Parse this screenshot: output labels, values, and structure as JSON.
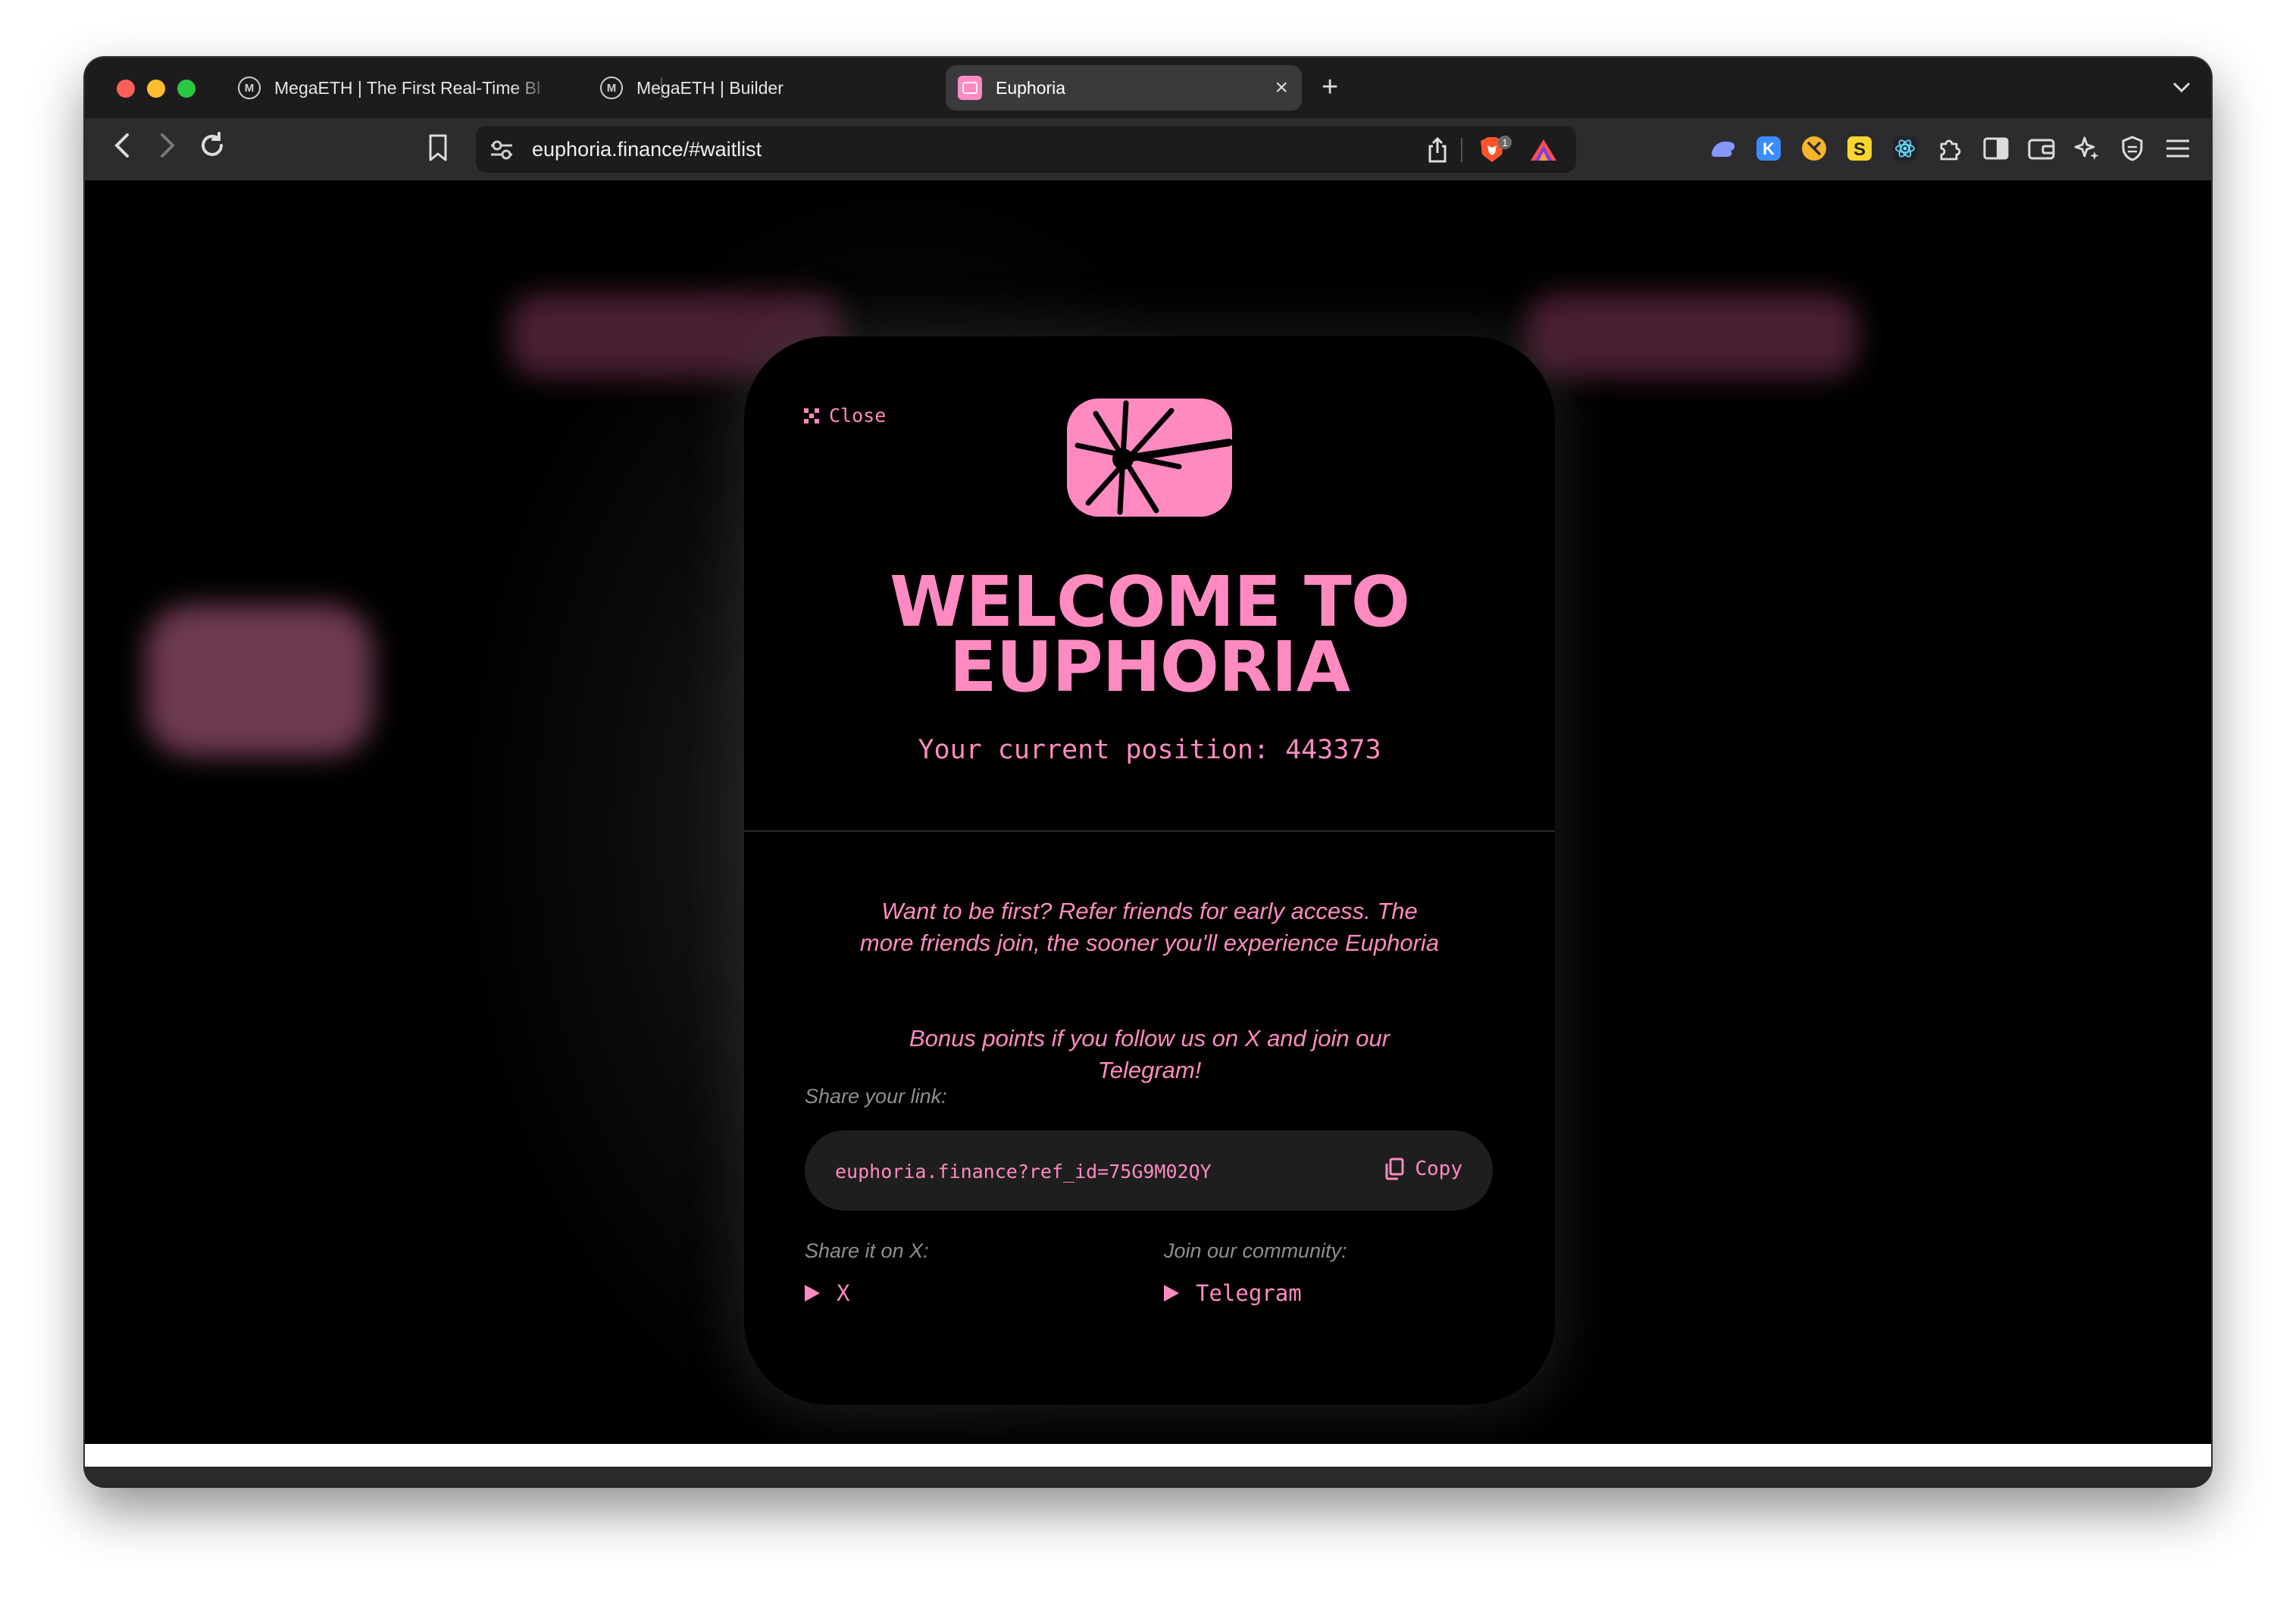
{
  "browser": {
    "tabs": [
      {
        "title": "MegaETH | The First Real-Time Bl",
        "favicon": "megaeth-logo-icon"
      },
      {
        "title": "MegaETH | Builder",
        "favicon": "megaeth-logo-icon"
      },
      {
        "title": "Euphoria",
        "favicon": "euphoria-logo-icon",
        "active": true
      }
    ],
    "favicon_letter": "M",
    "url": "euphoria.finance/#waitlist",
    "brave_badge": "1",
    "close_glyph": "×",
    "new_tab_glyph": "+"
  },
  "modal": {
    "close_label": "Close",
    "title_line1": "WELCOME TO",
    "title_line2": "EUPHORIA",
    "position_text": "Your current position: 443373",
    "refer_text": "Want to be first? Refer friends for early access. The more friends join, the sooner you'll experience Euphoria",
    "bonus_text": "Bonus points if you follow us on X and join our Telegram!",
    "share_link_label": "Share your link:",
    "share_link": "euphoria.finance?ref_id=75G9M02QY",
    "copy_label": "Copy",
    "share_x_label": "Share it on X:",
    "x_link": "X",
    "community_label": "Join our community:",
    "telegram_link": "Telegram"
  },
  "colors": {
    "accent": "#ff8ac2",
    "background": "#000000",
    "muted_text": "#8e8e8e"
  }
}
